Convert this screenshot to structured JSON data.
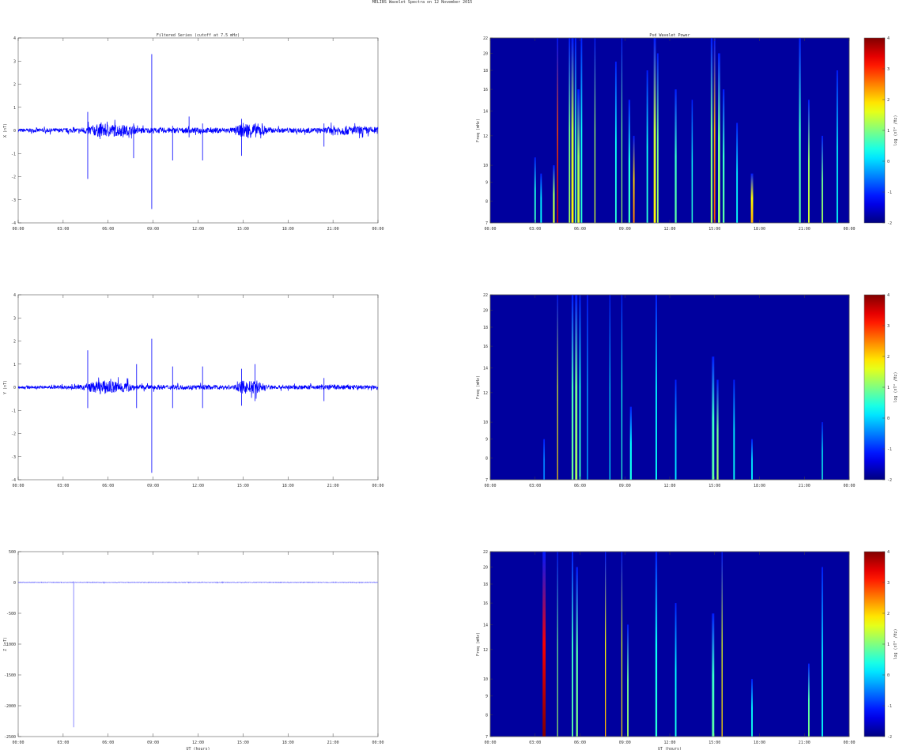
{
  "title": "MELIBS Wavelet Spectra on 12 November 2015",
  "chart_data": [
    {
      "type": "line",
      "panel": "X",
      "title": "Filtered Series (cutoff at 7.5 mHz)",
      "ylabel": "X (nT)",
      "xlabel": "",
      "ylim": [
        -4,
        4
      ],
      "yticks": [
        "-4",
        "-3",
        "-2",
        "-1",
        "0",
        "1",
        "2",
        "3",
        "4"
      ],
      "xticks": [
        "00:00",
        "03:00",
        "06:00",
        "09:00",
        "12:00",
        "15:00",
        "18:00",
        "21:00",
        "00:00"
      ],
      "noise_envelope": [
        [
          0,
          0.08
        ],
        [
          4,
          0.1
        ],
        [
          5.5,
          0.3
        ],
        [
          7,
          0.25
        ],
        [
          8,
          0.12
        ],
        [
          14.5,
          0.12
        ],
        [
          15,
          0.35
        ],
        [
          16,
          0.3
        ],
        [
          17,
          0.1
        ],
        [
          20.5,
          0.12
        ],
        [
          21,
          0.22
        ],
        [
          24,
          0.15
        ]
      ],
      "spikes": [
        {
          "t": 4.64,
          "min": -2.1,
          "max": 0.8
        },
        {
          "t": 7.7,
          "min": -1.2,
          "max": 0.3
        },
        {
          "t": 8.91,
          "min": -3.4,
          "max": 3.3
        },
        {
          "t": 10.3,
          "min": -1.3,
          "max": 0.2
        },
        {
          "t": 11.4,
          "min": -0.3,
          "max": 0.6
        },
        {
          "t": 12.3,
          "min": -1.3,
          "max": 0.3
        },
        {
          "t": 14.9,
          "min": -1.1,
          "max": 0.5
        },
        {
          "t": 20.4,
          "min": -0.7,
          "max": 0.3
        }
      ]
    },
    {
      "type": "line",
      "panel": "Y",
      "title": "",
      "ylabel": "Y (nT)",
      "xlabel": "",
      "ylim": [
        -4,
        4
      ],
      "yticks": [
        "-4",
        "-3",
        "-2",
        "-1",
        "0",
        "1",
        "2",
        "3",
        "4"
      ],
      "xticks": [
        "00:00",
        "03:00",
        "06:00",
        "09:00",
        "12:00",
        "15:00",
        "18:00",
        "21:00",
        "00:00"
      ],
      "noise_envelope": [
        [
          0,
          0.06
        ],
        [
          4,
          0.08
        ],
        [
          5.5,
          0.3
        ],
        [
          7,
          0.25
        ],
        [
          8,
          0.1
        ],
        [
          14.5,
          0.1
        ],
        [
          15,
          0.3
        ],
        [
          16,
          0.25
        ],
        [
          17,
          0.08
        ],
        [
          20.5,
          0.1
        ],
        [
          21,
          0.12
        ],
        [
          24,
          0.08
        ]
      ],
      "spikes": [
        {
          "t": 4.64,
          "min": -0.9,
          "max": 1.6
        },
        {
          "t": 7.9,
          "min": -0.9,
          "max": 1.0
        },
        {
          "t": 8.91,
          "min": -3.7,
          "max": 2.1
        },
        {
          "t": 10.3,
          "min": -0.9,
          "max": 0.9
        },
        {
          "t": 12.3,
          "min": -0.9,
          "max": 0.9
        },
        {
          "t": 14.9,
          "min": -0.8,
          "max": 0.8
        },
        {
          "t": 15.8,
          "min": -0.6,
          "max": 1.0
        },
        {
          "t": 20.4,
          "min": -0.6,
          "max": 0.4
        }
      ]
    },
    {
      "type": "line",
      "panel": "Z",
      "title": "",
      "ylabel": "Z (nT)",
      "xlabel": "UT (hours)",
      "ylim": [
        -2500,
        500
      ],
      "yticks": [
        "-2500",
        "-2000",
        "-1500",
        "-1000",
        "-500",
        "0",
        "500"
      ],
      "xticks": [
        "00:00",
        "03:00",
        "06:00",
        "09:00",
        "12:00",
        "15:00",
        "18:00",
        "21:00",
        "00:00"
      ],
      "noise_envelope": [
        [
          0,
          5
        ],
        [
          24,
          5
        ]
      ],
      "spikes": [
        {
          "t": 3.7,
          "min": -2350,
          "max": 20
        }
      ]
    },
    {
      "type": "heatmap",
      "panel": "X",
      "title": "Psd Wavelet Power",
      "ylabel": "Freq (mHz)",
      "xlabel": "",
      "ylim": [
        7,
        22
      ],
      "yticks": [
        "7",
        "8",
        "9",
        "10",
        "12",
        "14",
        "16",
        "18",
        "20",
        "22"
      ],
      "xticks": [
        "00:00",
        "03:00",
        "06:00",
        "09:00",
        "12:00",
        "15:00",
        "18:00",
        "21:00",
        "00:00"
      ],
      "colorbar": {
        "label": "log (nT² /Hz)",
        "range": [
          -2,
          4
        ],
        "ticks": [
          "-2",
          "-1",
          "0",
          "1",
          "2",
          "3",
          "4"
        ]
      },
      "events": [
        [
          3.0,
          10.5,
          0.6,
          0.1
        ],
        [
          3.4,
          9.5,
          0.3,
          0.1
        ],
        [
          4.5,
          22,
          3.5,
          0.08
        ],
        [
          4.25,
          10,
          1.5,
          0.12
        ],
        [
          5.3,
          22,
          1.2,
          0.1
        ],
        [
          5.5,
          22,
          1.8,
          0.15
        ],
        [
          5.7,
          22,
          0.8,
          0.1
        ],
        [
          5.9,
          16,
          1.5,
          0.15
        ],
        [
          6.1,
          22,
          0.5,
          0.1
        ],
        [
          7.0,
          22,
          1.5,
          0.07
        ],
        [
          8.4,
          19,
          0.5,
          0.1
        ],
        [
          8.8,
          22,
          1.2,
          0.06
        ],
        [
          9.3,
          15,
          0.6,
          0.12
        ],
        [
          9.6,
          12,
          2.5,
          0.1
        ],
        [
          10.5,
          18,
          0.5,
          0.1
        ],
        [
          11.0,
          22,
          1.8,
          0.15
        ],
        [
          11.2,
          20,
          1.2,
          0.1
        ],
        [
          12.4,
          16,
          0.8,
          0.12
        ],
        [
          13.5,
          15,
          0.5,
          0.08
        ],
        [
          14.8,
          22,
          1.2,
          0.12
        ],
        [
          15.0,
          22,
          2.8,
          0.1
        ],
        [
          15.3,
          20,
          1.2,
          0.15
        ],
        [
          15.6,
          16,
          0.8,
          0.12
        ],
        [
          16.5,
          13,
          0.3,
          0.1
        ],
        [
          17.5,
          9.5,
          2.2,
          0.15
        ],
        [
          20.7,
          22,
          0.8,
          0.12
        ],
        [
          21.3,
          15,
          1.5,
          0.1
        ],
        [
          22.2,
          12,
          1.2,
          0.1
        ],
        [
          23.2,
          18,
          0.3,
          0.1
        ]
      ]
    },
    {
      "type": "heatmap",
      "panel": "Y",
      "title": "",
      "ylabel": "Freq (mHz)",
      "xlabel": "",
      "ylim": [
        7,
        22
      ],
      "yticks": [
        "7",
        "8",
        "9",
        "10",
        "12",
        "14",
        "16",
        "18",
        "20",
        "22"
      ],
      "xticks": [
        "00:00",
        "03:00",
        "06:00",
        "09:00",
        "12:00",
        "15:00",
        "18:00",
        "21:00",
        "00:00"
      ],
      "colorbar": {
        "label": "log (nT² /Hz)",
        "range": [
          -2,
          4
        ],
        "ticks": [
          "-2",
          "-1",
          "0",
          "1",
          "2",
          "3",
          "4"
        ]
      },
      "events": [
        [
          3.6,
          9,
          -0.5,
          0.1
        ],
        [
          4.5,
          22,
          2.0,
          0.06
        ],
        [
          5.5,
          22,
          0.9,
          0.12
        ],
        [
          5.75,
          22,
          1.2,
          0.15
        ],
        [
          6.0,
          22,
          0.6,
          0.1
        ],
        [
          6.5,
          22,
          -0.3,
          0.08
        ],
        [
          8.0,
          22,
          0.2,
          0.06
        ],
        [
          8.8,
          22,
          0.5,
          0.06
        ],
        [
          9.4,
          11,
          0.4,
          0.12
        ],
        [
          11.1,
          22,
          0.3,
          0.1
        ],
        [
          12.4,
          13,
          0.1,
          0.1
        ],
        [
          14.9,
          15,
          0.8,
          0.15
        ],
        [
          15.2,
          13,
          1.2,
          0.12
        ],
        [
          16.3,
          13,
          0.3,
          0.1
        ],
        [
          17.5,
          9,
          0.2,
          0.1
        ],
        [
          22.2,
          10,
          0.4,
          0.08
        ]
      ]
    },
    {
      "type": "heatmap",
      "panel": "Z",
      "title": "",
      "ylabel": "Freq (mHz)",
      "xlabel": "UT (hours)",
      "ylim": [
        7,
        22
      ],
      "yticks": [
        "7",
        "8",
        "9",
        "10",
        "12",
        "14",
        "16",
        "18",
        "20",
        "22"
      ],
      "xticks": [
        "00:00",
        "03:00",
        "06:00",
        "09:00",
        "12:00",
        "15:00",
        "18:00",
        "21:00",
        "00:00"
      ],
      "colorbar": {
        "label": "log (nT² /Hz)",
        "range": [
          -2,
          4
        ],
        "ticks": [
          "-2",
          "-1",
          "0",
          "1",
          "2",
          "3",
          "4"
        ]
      },
      "events": [
        [
          3.6,
          22,
          4.0,
          0.2
        ],
        [
          4.5,
          22,
          1.2,
          0.06
        ],
        [
          5.5,
          22,
          0.8,
          0.1
        ],
        [
          5.8,
          20,
          1.0,
          0.12
        ],
        [
          7.7,
          22,
          2.2,
          0.07
        ],
        [
          8.8,
          22,
          2.0,
          0.06
        ],
        [
          9.2,
          14,
          1.2,
          0.1
        ],
        [
          11.1,
          22,
          0.5,
          0.12
        ],
        [
          12.4,
          16,
          0.4,
          0.1
        ],
        [
          14.9,
          15,
          0.8,
          0.15
        ],
        [
          15.5,
          22,
          2.0,
          0.07
        ],
        [
          17.5,
          10,
          0.4,
          0.1
        ],
        [
          21.3,
          11,
          1.0,
          0.1
        ],
        [
          22.2,
          20,
          0.3,
          0.1
        ]
      ]
    }
  ]
}
